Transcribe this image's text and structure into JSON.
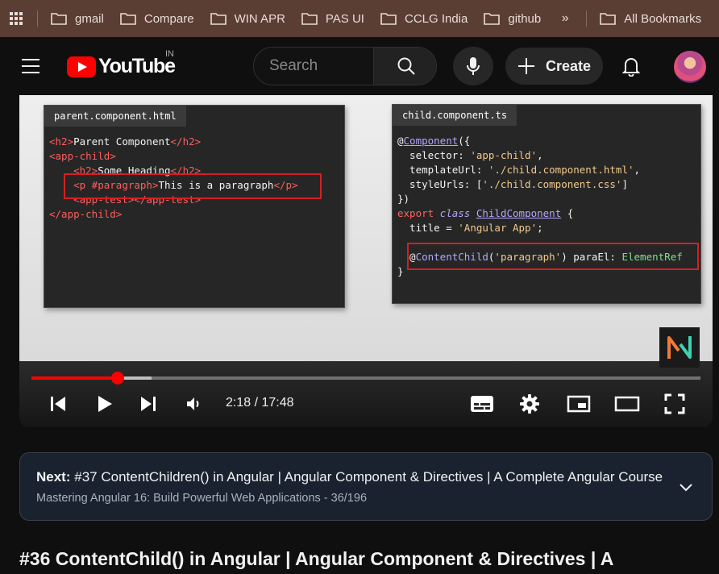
{
  "bookmarks": {
    "items": [
      "gmail",
      "Compare",
      "WIN APR",
      "PAS UI",
      "CCLG India",
      "github"
    ],
    "overflow": "»",
    "all_bookmarks": "All Bookmarks"
  },
  "masthead": {
    "logo_text": "YouTube",
    "country_code": "IN",
    "search_placeholder": "Search",
    "create_label": "Create"
  },
  "video": {
    "code_left": {
      "tab": "parent.component.html"
    },
    "code_right": {
      "tab": "child.component.ts"
    },
    "time_display": "2:18 / 17:48",
    "progress_played_fraction": 0.129,
    "progress_buffered_fraction": 0.18
  },
  "next": {
    "prefix": "Next:",
    "title": "#37 ContentChildren() in Angular | Angular Component & Directives | A Complete Angular Course",
    "playlist": "Mastering Angular 16: Build Powerful Web Applications",
    "position": "- 36/196"
  },
  "title": "#36 ContentChild() in Angular | Angular Component & Directives | A",
  "colors": {
    "bookmarks_bg": "#5a3d33",
    "page_bg": "#0f0f0f",
    "progress": "#ff0000",
    "next_card_bg": "#1a2230"
  }
}
